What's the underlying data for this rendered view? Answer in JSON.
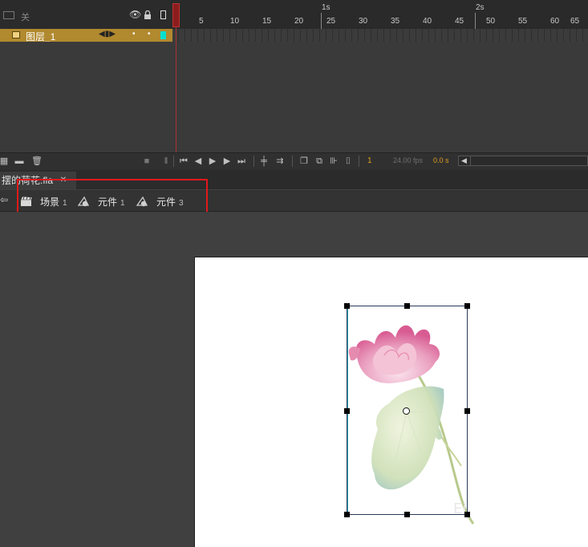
{
  "timeline": {
    "header_label": "关",
    "ruler_frames": [
      "1",
      "5",
      "10",
      "15",
      "20",
      "25",
      "30",
      "35",
      "40",
      "45",
      "50",
      "55",
      "60",
      "65"
    ],
    "ruler_seconds": [
      "1s",
      "2s"
    ],
    "layers": [
      {
        "name": "图层_1",
        "color": "#00e0d0"
      }
    ],
    "current_frame": "1",
    "fps": "24.00 fps",
    "elapsed": "0.0 s"
  },
  "document": {
    "tab_title": "摆的荷花.fla"
  },
  "breadcrumb": [
    {
      "icon": "scene-clapper-icon",
      "label": "场景",
      "num": "1"
    },
    {
      "icon": "graphic-symbol-icon",
      "label": "元件",
      "num": "1"
    },
    {
      "icon": "graphic-symbol-icon",
      "label": "元件",
      "num": "3"
    }
  ],
  "colors": {
    "layer_highlight": "#b1892e",
    "playhead": "#8c1d1d",
    "annotation_box": "#e0191c",
    "stage_bg": "#ffffff"
  }
}
